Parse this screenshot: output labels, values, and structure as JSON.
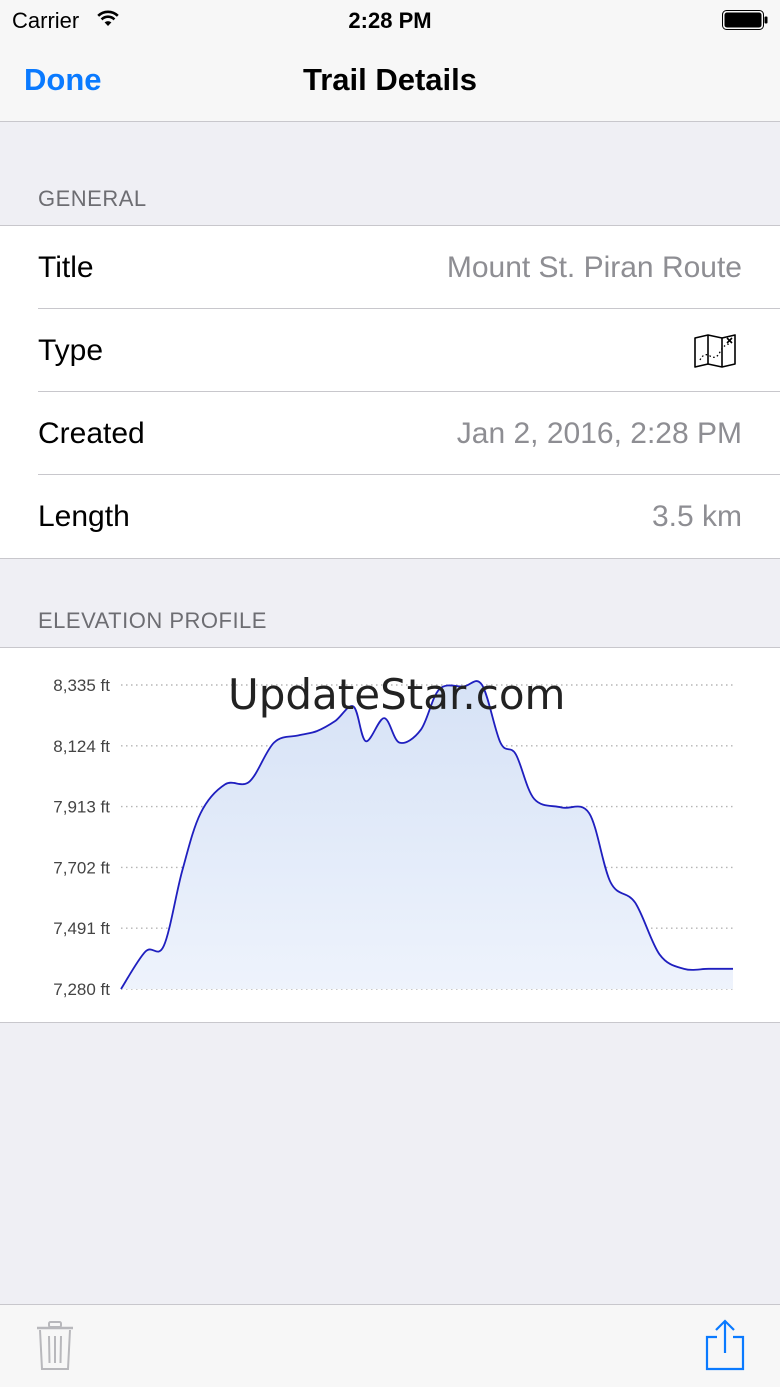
{
  "status_bar": {
    "carrier": "Carrier",
    "time": "2:28 PM",
    "wifi_icon": "wifi-icon",
    "battery_icon": "battery-icon"
  },
  "nav": {
    "back_label": "Done",
    "title": "Trail Details"
  },
  "general": {
    "header": "GENERAL",
    "rows": [
      {
        "label": "Title",
        "value": "Mount St. Piran Route"
      },
      {
        "label": "Type",
        "icon": "map-icon"
      },
      {
        "label": "Created",
        "value": "Jan 2, 2016, 2:28 PM"
      },
      {
        "label": "Length",
        "value": "3.5 km"
      }
    ]
  },
  "elevation": {
    "header": "ELEVATION PROFILE"
  },
  "chart_data": {
    "type": "area",
    "y_tick_labels": [
      "8,335 ft",
      "8,124 ft",
      "7,913 ft",
      "7,702 ft",
      "7,491 ft",
      "7,280 ft"
    ],
    "ylim": [
      7280,
      8335
    ],
    "grid": true,
    "x": [
      0,
      0.04,
      0.07,
      0.1,
      0.13,
      0.17,
      0.21,
      0.25,
      0.29,
      0.32,
      0.35,
      0.38,
      0.4,
      0.43,
      0.455,
      0.49,
      0.52,
      0.56,
      0.59,
      0.62,
      0.645,
      0.675,
      0.72,
      0.765,
      0.8,
      0.84,
      0.88,
      0.92,
      0.96,
      1.0
    ],
    "values": [
      7280,
      7410,
      7430,
      7690,
      7890,
      7990,
      8000,
      8135,
      8160,
      8175,
      8210,
      8260,
      8140,
      8220,
      8135,
      8180,
      8320,
      8330,
      8335,
      8135,
      8095,
      7940,
      7910,
      7890,
      7650,
      7580,
      7400,
      7350,
      7350,
      7350
    ],
    "line_color": "#1f1fbf",
    "fill_color": "#dfe8f8"
  },
  "watermark": "UpdateStar.com",
  "toolbar": {
    "trash_icon": "trash-icon",
    "share_icon": "share-icon"
  }
}
